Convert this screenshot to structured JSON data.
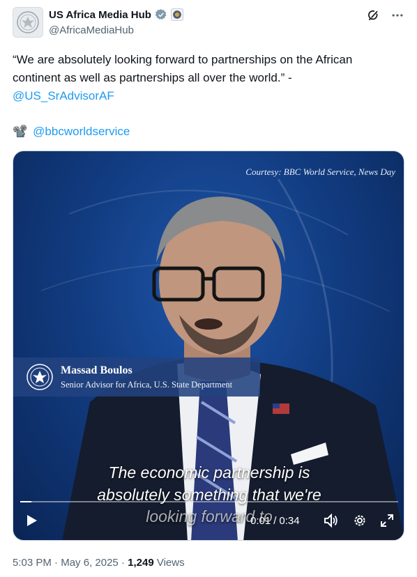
{
  "author": {
    "display_name": "US Africa Media Hub",
    "handle": "@AfricaMediaHub",
    "verified_color": "#829aab"
  },
  "post": {
    "quote": "“We are absolutely looking forward to partnerships on the African continent as well as partnerships all over the world.” -",
    "mention": "@US_SrAdvisorAF",
    "camera_emoji": "📽️",
    "credit_mention": "@bbcworldservice"
  },
  "video": {
    "courtesy": "Courtesy: BBC World Service, News Day",
    "lower_third": {
      "name": "Massad Boulos",
      "title": "Senior Advisor for Africa, U.S. State Department"
    },
    "caption_lines": [
      "The economic partnership is",
      "absolutely something that we're",
      "looking forward to"
    ],
    "current_time": "0:01",
    "duration": "0:34",
    "progress_fraction": 0.03
  },
  "meta": {
    "time": "5:03 PM",
    "date": "May 6, 2025",
    "views_count": "1,249",
    "views_label": "Views"
  },
  "colors": {
    "link": "#1d9bf0",
    "muted": "#536471",
    "text": "#0f1419"
  }
}
